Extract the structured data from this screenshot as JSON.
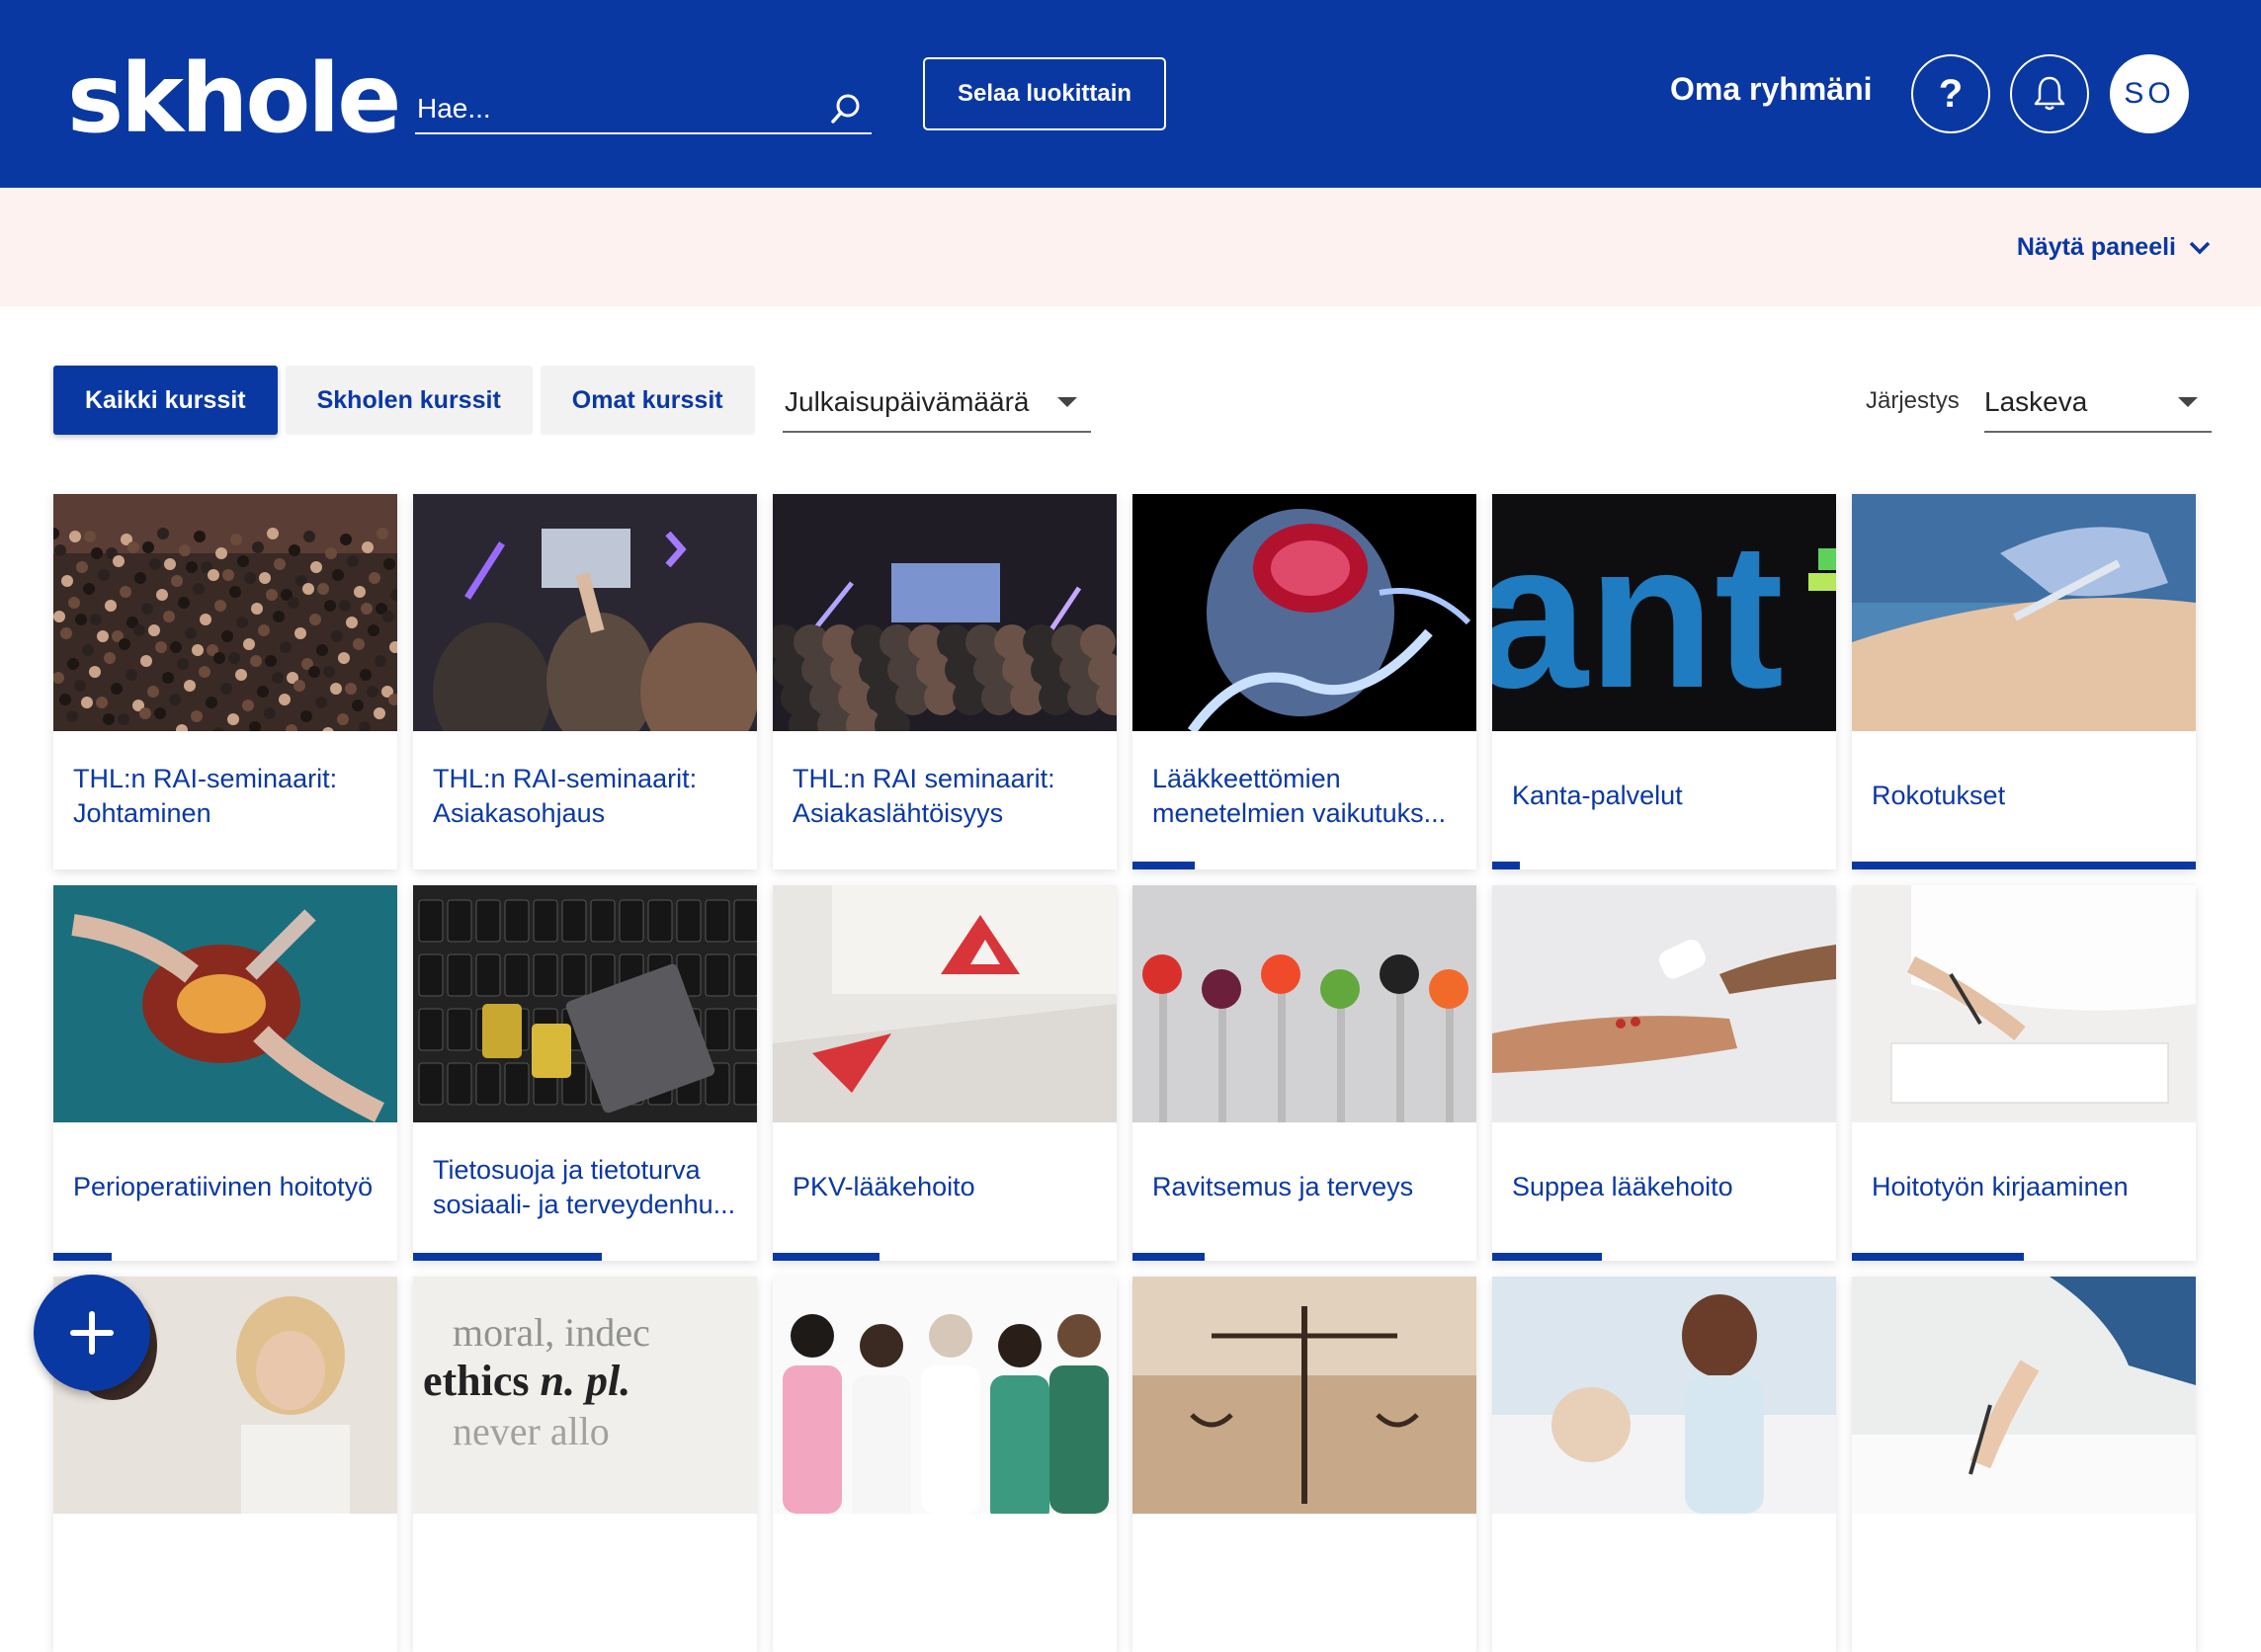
{
  "header": {
    "logo": "skhole",
    "search_placeholder": "Hae...",
    "browse_label": "Selaa luokittain",
    "group_label": "Oma ryhmäni",
    "help_label": "?",
    "avatar_initials": "SO"
  },
  "panel": {
    "toggle_label": "Näytä paneeli"
  },
  "tabs": [
    {
      "label": "Kaikki kurssit",
      "active": true
    },
    {
      "label": "Skholen kurssit",
      "active": false
    },
    {
      "label": "Omat kurssit",
      "active": false
    }
  ],
  "filters": {
    "sort_field": "Julkaisupäivämäärä",
    "order_label": "Järjestys",
    "order_value": "Laskeva"
  },
  "courses": [
    {
      "title": "THL:n RAI-seminaarit: Johtaminen",
      "progress": 0,
      "image": "audience-hall"
    },
    {
      "title": "THL:n RAI-seminaarit: Asiakasohjaus",
      "progress": 0,
      "image": "concert-audience"
    },
    {
      "title": "THL:n RAI seminaarit: Asiakaslähtöisyys",
      "progress": 0,
      "image": "stage-audience"
    },
    {
      "title": "Lääkkeettömien menetelmien vaikutuks...",
      "progress": 0.18,
      "image": "xray-brain"
    },
    {
      "title": "Kanta-palvelut",
      "progress": 0.08,
      "image": "kanta-logo"
    },
    {
      "title": "Rokotukset",
      "progress": 1.0,
      "image": "vaccination"
    },
    {
      "title": "Perioperatiivinen hoitotyö",
      "progress": 0.17,
      "image": "surgery"
    },
    {
      "title": "Tietosuoja ja tietoturva sosiaali- ja terveydenhu...",
      "progress": 0.55,
      "image": "padlock-keyboard"
    },
    {
      "title": "PKV-lääkehoito",
      "progress": 0.31,
      "image": "warning-box"
    },
    {
      "title": "Ravitsemus ja terveys",
      "progress": 0.21,
      "image": "food-forks"
    },
    {
      "title": "Suppea lääkehoito",
      "progress": 0.32,
      "image": "pills-hands"
    },
    {
      "title": "Hoitotyön kirjaaminen",
      "progress": 0.5,
      "image": "writing-nurse"
    },
    {
      "title": "",
      "progress": 0,
      "image": "women-talking"
    },
    {
      "title": "",
      "progress": 0,
      "image": "ethics-text"
    },
    {
      "title": "",
      "progress": 0,
      "image": "medical-staff"
    },
    {
      "title": "",
      "progress": 0,
      "image": "justice-scale"
    },
    {
      "title": "",
      "progress": 0,
      "image": "nurse-patient"
    },
    {
      "title": "",
      "progress": 0,
      "image": "hand-writing"
    }
  ],
  "colors": {
    "brand": "#0a38a3",
    "panel_bg": "#fdf2ef"
  },
  "fab": {
    "icon": "plus-icon"
  }
}
